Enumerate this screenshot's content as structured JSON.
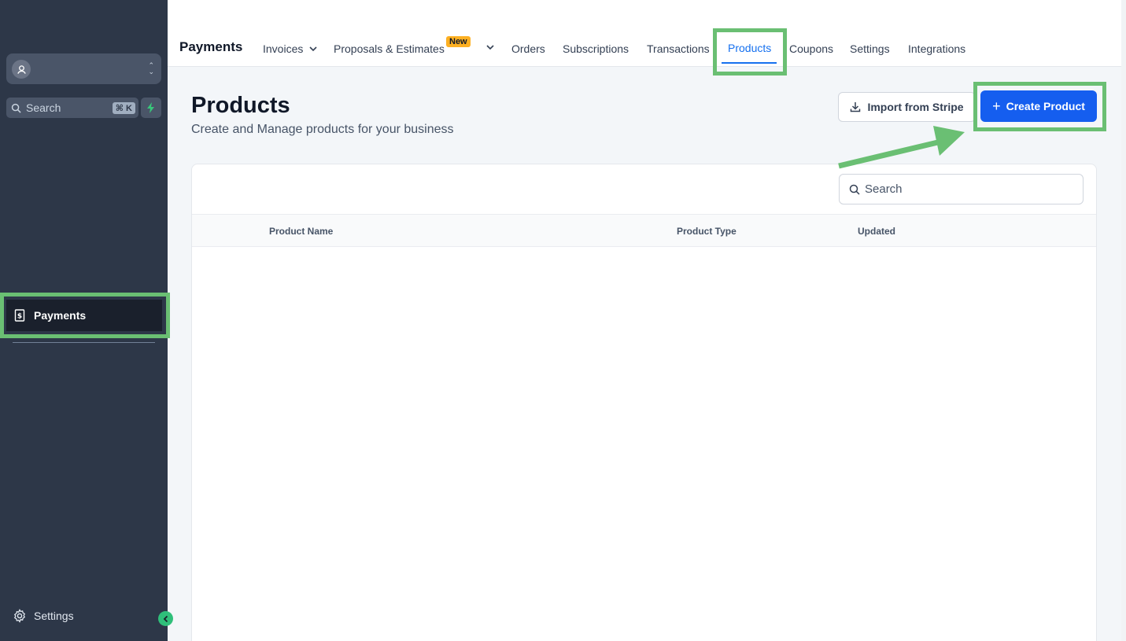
{
  "sidebar": {
    "search_placeholder": "Search",
    "shortcut": "⌘ K",
    "active_item": "Payments",
    "footer_item": "Settings"
  },
  "topnav": {
    "app_title": "Payments",
    "items": [
      {
        "label": "Invoices"
      },
      {
        "label": "Proposals & Estimates",
        "badge": "New"
      },
      {
        "label": "Orders"
      },
      {
        "label": "Subscriptions"
      },
      {
        "label": "Transactions"
      },
      {
        "label": "Products",
        "active": true
      },
      {
        "label": "Coupons"
      },
      {
        "label": "Settings"
      },
      {
        "label": "Integrations"
      }
    ]
  },
  "page": {
    "title": "Products",
    "subtitle": "Create and Manage products for your business",
    "import_label": "Import from Stripe",
    "create_label": "Create Product"
  },
  "table": {
    "search_placeholder": "Search",
    "columns": [
      "Product Name",
      "Product Type",
      "Updated"
    ],
    "rows": []
  },
  "colors": {
    "accent": "#155eef",
    "highlight": "#6abf73",
    "sidebar": "#2d3748"
  }
}
